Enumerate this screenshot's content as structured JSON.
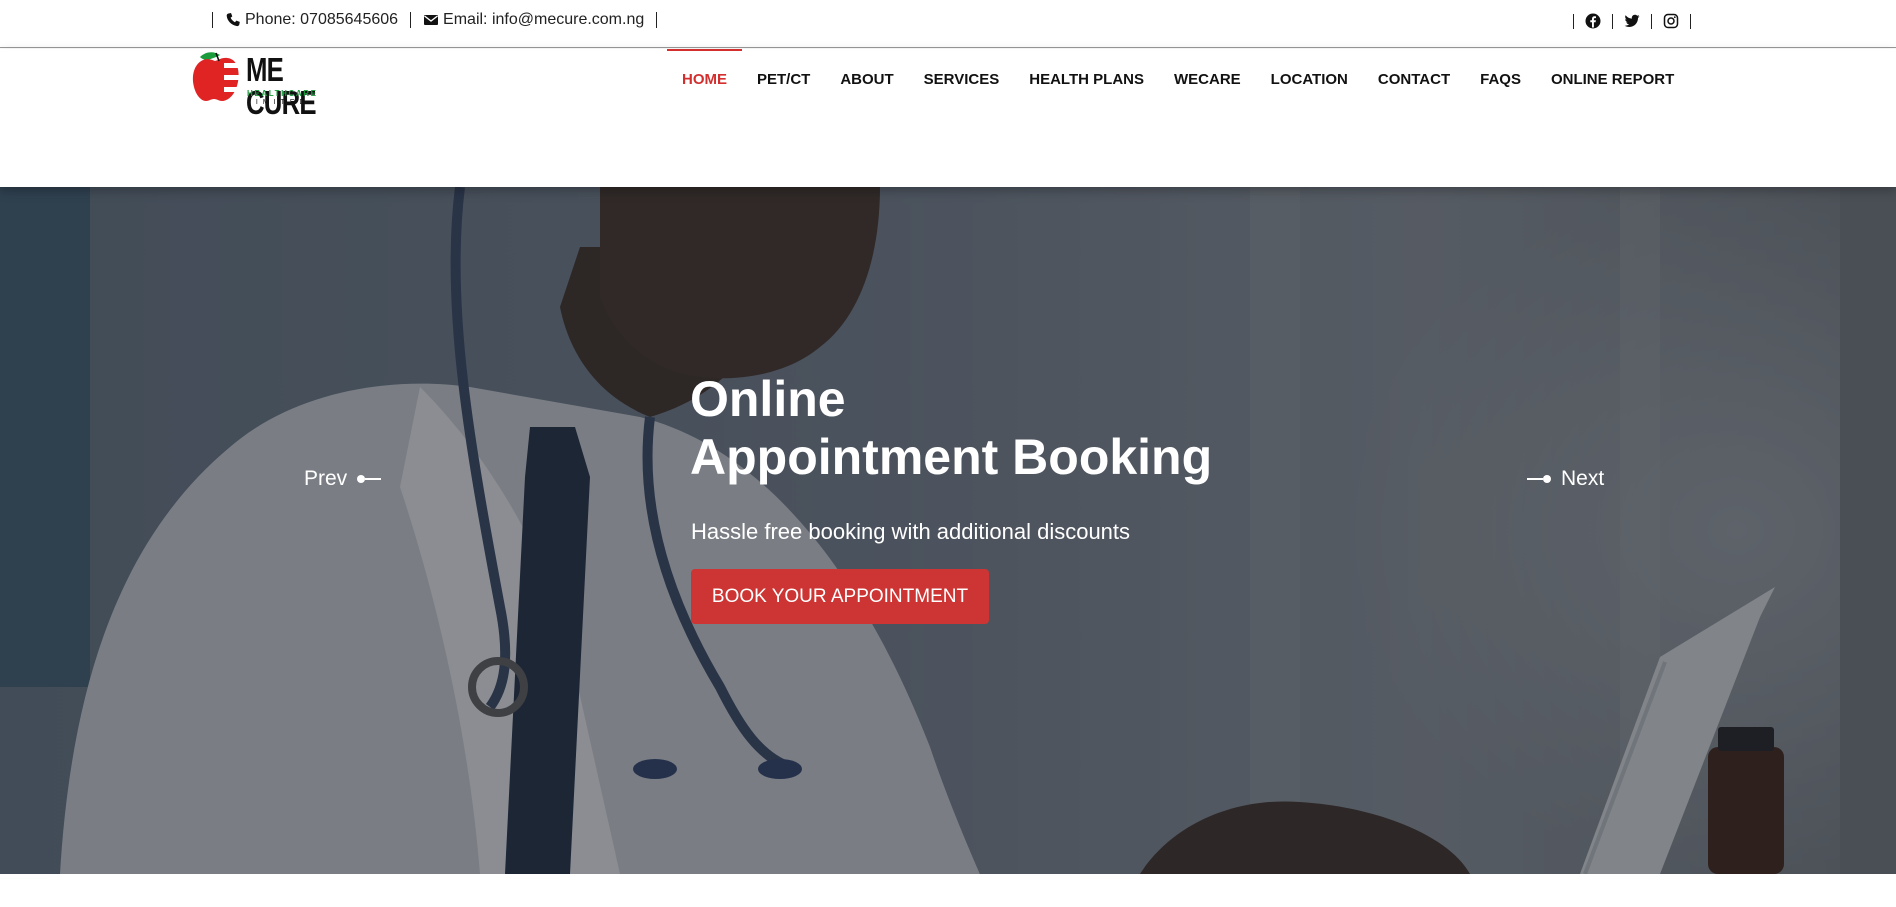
{
  "topbar": {
    "phone_label": "Phone: 07085645606",
    "email_label": "Email: info@mecure.com.ng",
    "social": [
      "facebook-icon",
      "twitter-icon",
      "instagram-icon"
    ]
  },
  "logo": {
    "name": "ME CURE",
    "line1": "HEALTHCARE",
    "line2": "LIMITED",
    "colors": {
      "apple": "#e02424",
      "leaf": "#1a9b3c"
    }
  },
  "nav": {
    "items": [
      {
        "label": "HOME",
        "active": true
      },
      {
        "label": "PET/CT"
      },
      {
        "label": "ABOUT"
      },
      {
        "label": "SERVICES"
      },
      {
        "label": "HEALTH PLANS"
      },
      {
        "label": "WECARE"
      },
      {
        "label": "LOCATION"
      },
      {
        "label": "CONTACT"
      },
      {
        "label": "FAQS"
      },
      {
        "label": "ONLINE REPORT"
      }
    ],
    "active_color": "#d32f2f"
  },
  "hero": {
    "title_line1": "Online",
    "title_line2": "Appointment Booking",
    "subtitle": "Hassle free booking with additional discounts",
    "button_label": "BOOK YOUR APPOINTMENT",
    "button_color": "#cc3533",
    "prev_label": "Prev",
    "next_label": "Next"
  }
}
